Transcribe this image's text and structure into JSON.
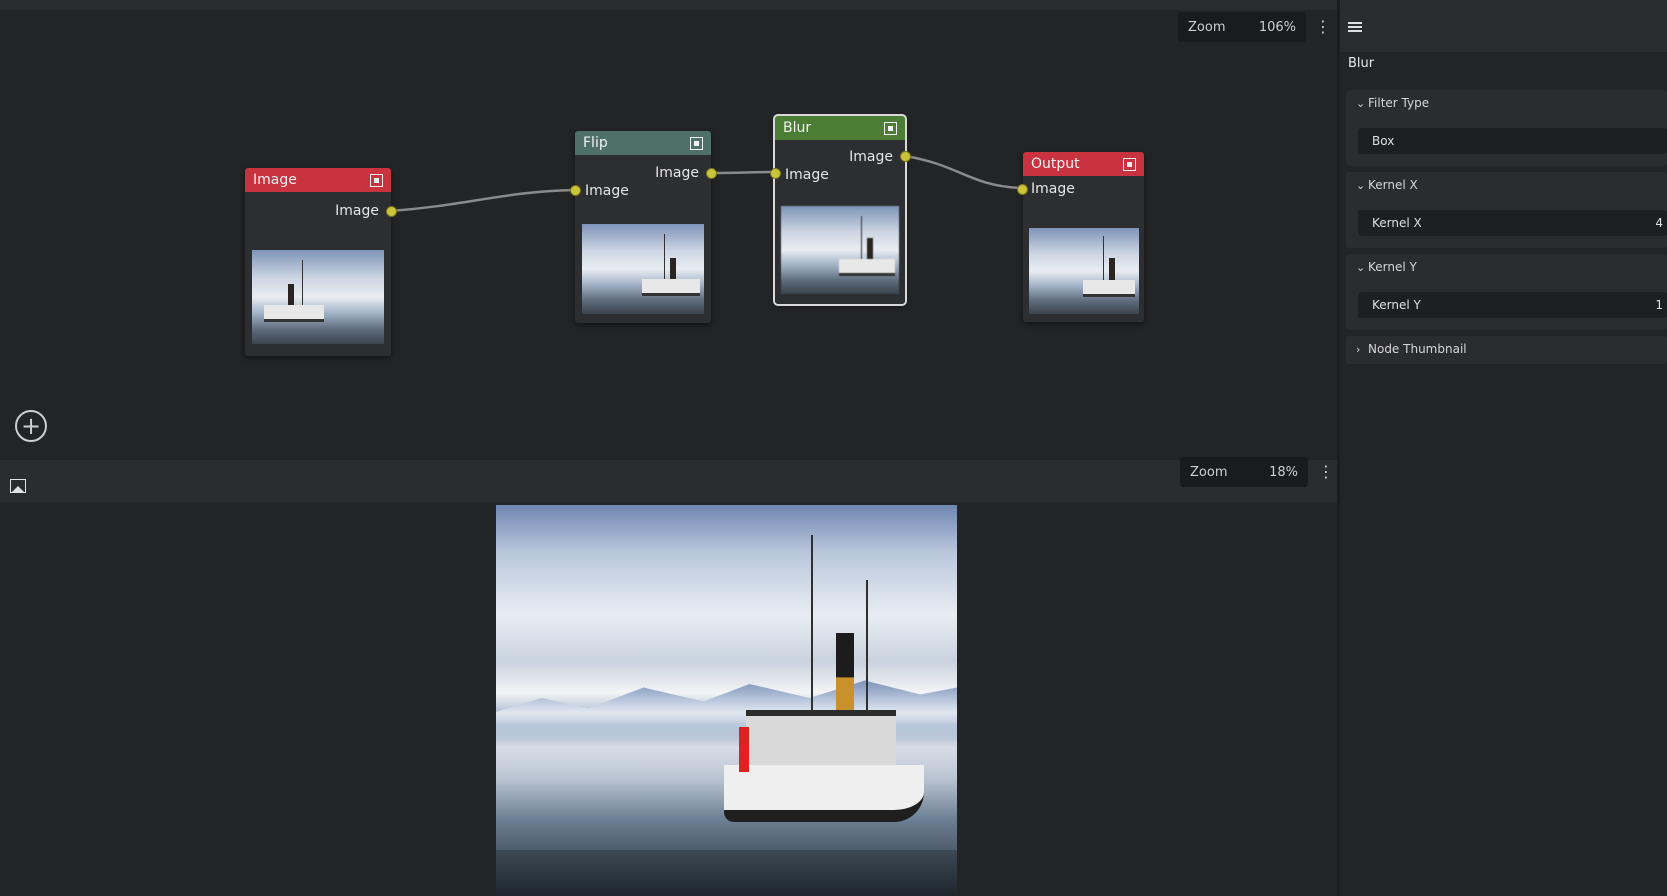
{
  "editor": {
    "zoom_label": "Zoom",
    "zoom_value": "106%",
    "nodes": {
      "image": {
        "title": "Image",
        "color": "#c9323f",
        "output_label": "Image"
      },
      "flip": {
        "title": "Flip",
        "color": "#4f6f69",
        "input_label": "Image",
        "output_label": "Image"
      },
      "blur": {
        "title": "Blur",
        "color": "#4b7d34",
        "input_label": "Image",
        "output_label": "Image"
      },
      "output": {
        "title": "Output",
        "color": "#c9323f",
        "input_label": "Image"
      }
    },
    "port_color": "#c9c43a"
  },
  "viewer": {
    "zoom_label": "Zoom",
    "zoom_value": "18%"
  },
  "panel": {
    "node_name": "Blur",
    "sections": {
      "filter_type": {
        "label": "Filter Type",
        "value": "Box"
      },
      "kernel_x": {
        "label": "Kernel X",
        "field_label": "Kernel X",
        "value": "4"
      },
      "kernel_y": {
        "label": "Kernel Y",
        "field_label": "Kernel Y",
        "value": "1"
      },
      "node_thumbnail": {
        "label": "Node Thumbnail"
      }
    }
  },
  "icons": [
    "node-preview-icon",
    "add-node-icon",
    "kebab-menu-icon",
    "image-icon",
    "sliders-icon",
    "chevron-down-icon",
    "chevron-right-icon"
  ]
}
